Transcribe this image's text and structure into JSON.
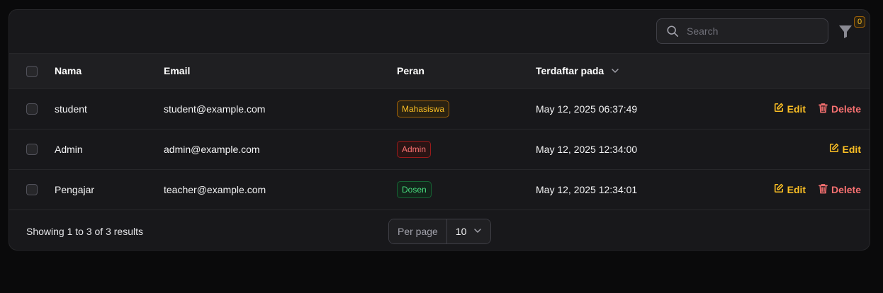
{
  "search": {
    "placeholder": "Search",
    "value": ""
  },
  "filter": {
    "active_count": "0"
  },
  "table": {
    "columns": [
      "Nama",
      "Email",
      "Peran",
      "Terdaftar pada"
    ],
    "sorted_column": "Terdaftar pada",
    "rows": [
      {
        "name": "student",
        "email": "student@example.com",
        "role": "Mahasiswa",
        "registered": "May 12, 2025 06:37:49",
        "edit": "Edit",
        "delete": "Delete"
      },
      {
        "name": "Admin",
        "email": "admin@example.com",
        "role": "Admin",
        "registered": "May 12, 2025 12:34:00",
        "edit": "Edit"
      },
      {
        "name": "Pengajar",
        "email": "teacher@example.com",
        "role": "Dosen",
        "registered": "May 12, 2025 12:34:01",
        "edit": "Edit",
        "delete": "Delete"
      }
    ]
  },
  "role_colors": {
    "Mahasiswa": {
      "text": "#fbbf24",
      "border": "#a16207",
      "bg": "#2a2212"
    },
    "Admin": {
      "text": "#f87171",
      "border": "#991b1b",
      "bg": "#2a1414"
    },
    "Dosen": {
      "text": "#4ade80",
      "border": "#166534",
      "bg": "#12241a"
    }
  },
  "footer": {
    "summary": "Showing 1 to 3 of 3 results",
    "per_page_label": "Per page",
    "per_page_value": "10"
  },
  "icons": {
    "search": "search-icon",
    "filter": "filter-icon",
    "sort": "chevron-down-icon",
    "edit": "pencil-square-icon",
    "delete": "trash-icon"
  },
  "colors": {
    "accent": "#fbbf24",
    "danger": "#f87171"
  }
}
